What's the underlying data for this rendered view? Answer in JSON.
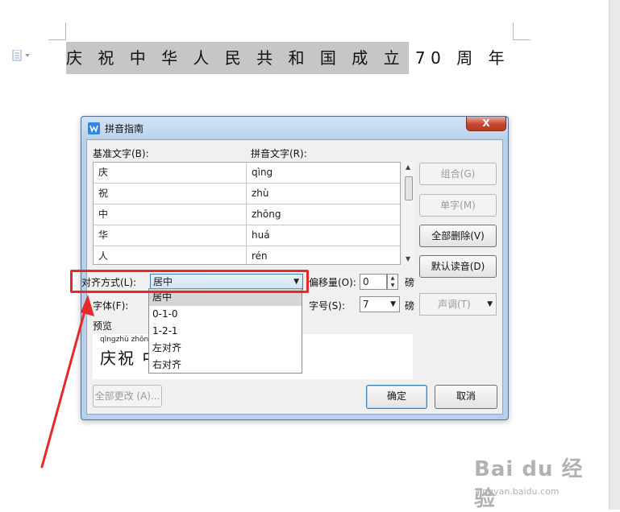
{
  "document": {
    "text": "庆 祝 中 华 人 民 共 和 国 成 立  70  周 年"
  },
  "dialog": {
    "title": "拼音指南",
    "close_label": "X",
    "base_text_label": "基准文字(B):",
    "pinyin_text_label": "拼音文字(R):",
    "rows": [
      {
        "char": "庆",
        "pinyin": "qìng"
      },
      {
        "char": "祝",
        "pinyin": "zhù"
      },
      {
        "char": "中",
        "pinyin": "zhōng"
      },
      {
        "char": "华",
        "pinyin": "huá"
      },
      {
        "char": "人",
        "pinyin": "rén"
      }
    ],
    "buttons": {
      "combine": "组合(G)",
      "single": "单字(M)",
      "clear_all": "全部删除(V)",
      "default_reading": "默认读音(D)",
      "change_all": "全部更改 (A)...",
      "ok": "确定",
      "cancel": "取消"
    },
    "alignment": {
      "label": "对齐方式(L):",
      "value": "居中",
      "options": [
        "居中",
        "0-1-0",
        "1-2-1",
        "左对齐",
        "右对齐"
      ]
    },
    "offset": {
      "label": "偏移量(O):",
      "value": "0",
      "unit": "磅"
    },
    "font": {
      "label": "字体(F):"
    },
    "size": {
      "label": "字号(S):",
      "value": "7",
      "unit": "磅"
    },
    "tone": {
      "label": "声调(T)"
    },
    "preview": {
      "label": "预览",
      "pinyin": "qìngzhù zhōn",
      "hanzi": "庆祝 中"
    }
  },
  "watermark": {
    "main": "Bai du 经验",
    "sub": "jingyan.baidu.com"
  },
  "colors": {
    "annotation": "#e8282a",
    "dialog_frame": "#b8d0ea",
    "highlight": "#d6d6d6"
  }
}
